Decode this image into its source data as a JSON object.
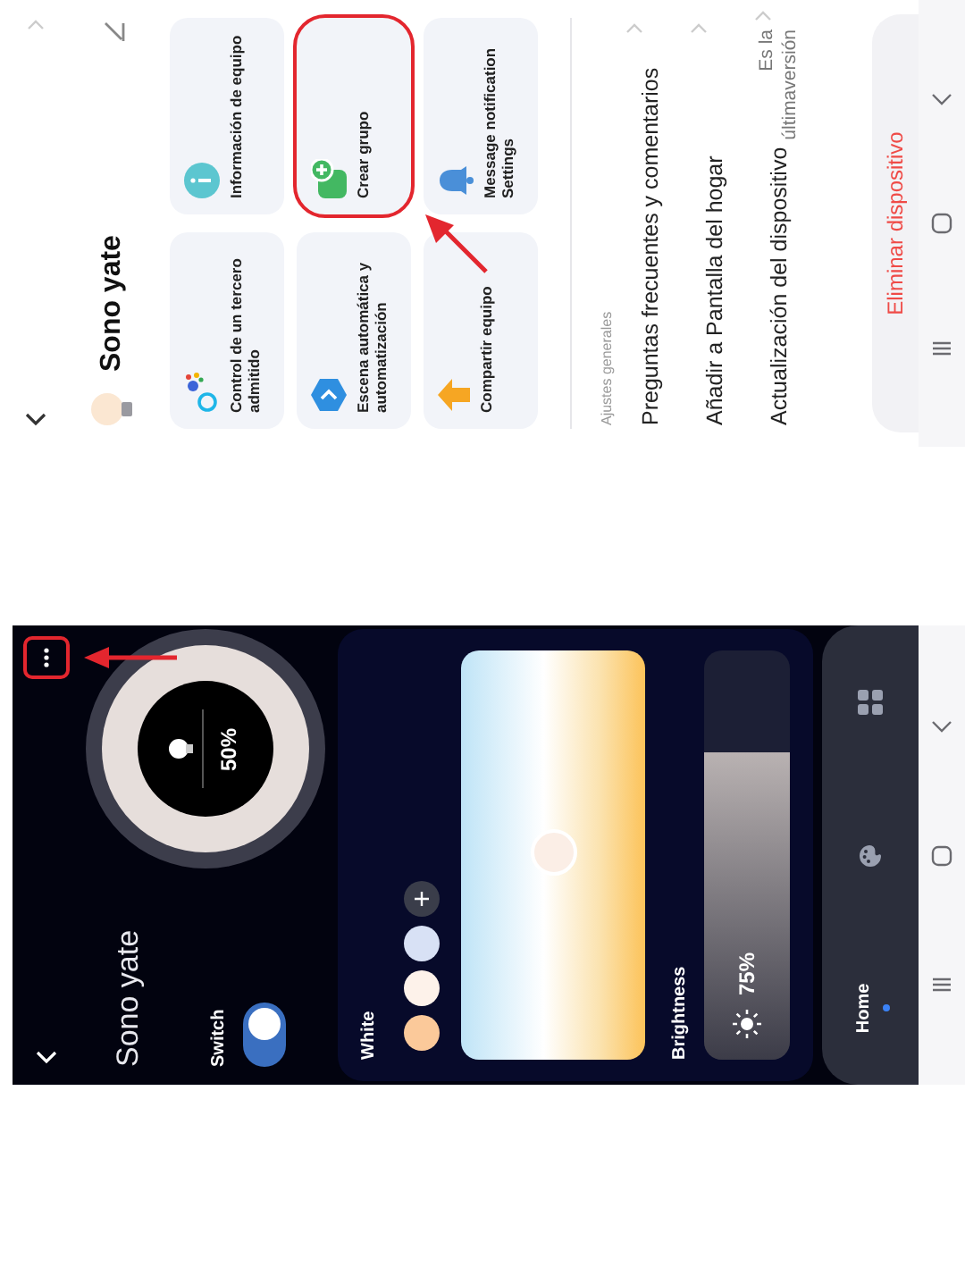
{
  "settings_screen": {
    "title": "Sono yate",
    "cards": [
      {
        "label": "Control de un tercero admitido",
        "highlighted": false
      },
      {
        "label": "Información de equipo",
        "highlighted": false
      },
      {
        "label": "Escena automática y automatización",
        "highlighted": false
      },
      {
        "label": "Crear grupo",
        "highlighted": true
      },
      {
        "label": "Compartir equipo",
        "highlighted": false
      },
      {
        "label": "Message notification Settings",
        "highlighted": false
      }
    ],
    "section_label": "Ajustes generales",
    "rows": [
      {
        "label": "Preguntas frecuentes y comentarios"
      },
      {
        "label": "Añadir a Pantalla del hogar"
      },
      {
        "label": "Actualización del dispositivo",
        "value": "Es la últimaversión"
      }
    ],
    "delete_button": "Eliminar dispositivo"
  },
  "control_screen": {
    "title": "Sono yate",
    "menu_highlighted": true,
    "knob": {
      "reading": "50%"
    },
    "switch": {
      "label": "Switch",
      "on": true
    },
    "white": {
      "label": "White",
      "swatches": [
        {
          "color": "#fbc99a"
        },
        {
          "color": "#fdf2ea"
        },
        {
          "color": "#d8e1f5"
        }
      ]
    },
    "brightness": {
      "label": "Brightness",
      "level": 0.75,
      "reading": "75%"
    },
    "tabs": [
      {
        "label": "Home",
        "selected": true
      },
      {
        "selected": false
      },
      {
        "selected": false
      }
    ]
  }
}
